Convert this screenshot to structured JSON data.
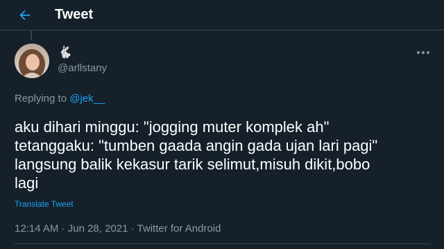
{
  "header": {
    "title": "Tweet",
    "back_icon": "arrow-left-icon"
  },
  "colors": {
    "background": "#15202b",
    "accent": "#1da1f2",
    "text_primary": "#ffffff",
    "text_secondary": "#8899a6",
    "divider": "#38444d"
  },
  "author": {
    "display_name_emoji": "🐇",
    "handle": "@arllstany",
    "avatar_icon": "user-avatar"
  },
  "more_icon": "more-horizontal-icon",
  "replying": {
    "prefix": "Replying to ",
    "mention": "@jek__"
  },
  "tweet": {
    "text": "aku dihari minggu: \"jogging muter komplek ah\"\ntetanggaku: \"tumben gaada angin gada ujan lari pagi\"\nlangsung balik kekasur tarik selimut,misuh dikit,bobo\nlagi",
    "translate_label": "Translate Tweet"
  },
  "meta": {
    "time": "12:14 AM",
    "separator": " · ",
    "date": "Jun 28, 2021",
    "source": "Twitter for Android"
  }
}
